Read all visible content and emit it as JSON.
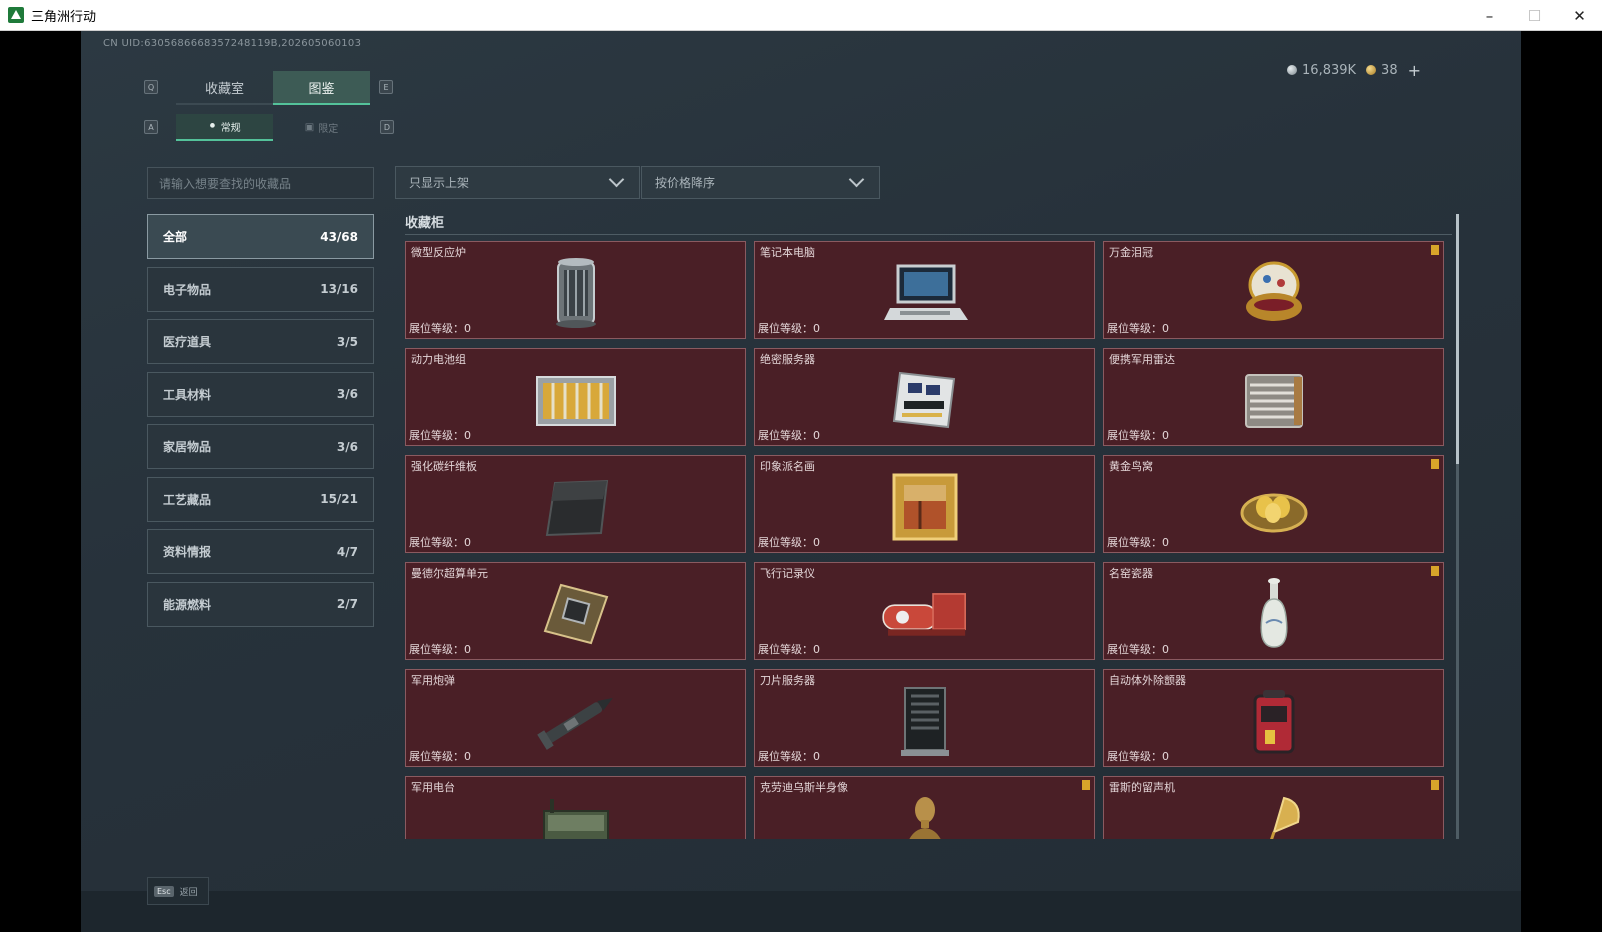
{
  "window": {
    "title": "三角洲行动"
  },
  "header": {
    "uid": "CN UID:6305686668357248119B,202605060103"
  },
  "currency": {
    "silver": "16,839K",
    "gold": "38"
  },
  "keys": {
    "tab_left": "Q",
    "tab_right": "E",
    "sub_left": "A",
    "sub_right": "D"
  },
  "tabs": [
    {
      "label": "收藏室"
    },
    {
      "label": "图鉴"
    }
  ],
  "subtabs": [
    {
      "label": "常规"
    },
    {
      "label": "限定"
    }
  ],
  "search": {
    "placeholder": "请输入想要查找的收藏品"
  },
  "filters": {
    "listing": "只显示上架",
    "sort": "按价格降序"
  },
  "categories": [
    {
      "label": "全部",
      "count": "43/68"
    },
    {
      "label": "电子物品",
      "count": "13/16"
    },
    {
      "label": "医疗道具",
      "count": "3/5"
    },
    {
      "label": "工具材料",
      "count": "3/6"
    },
    {
      "label": "家居物品",
      "count": "3/6"
    },
    {
      "label": "工艺藏品",
      "count": "15/21"
    },
    {
      "label": "资料情报",
      "count": "4/7"
    },
    {
      "label": "能源燃料",
      "count": "2/7"
    }
  ],
  "section": {
    "title": "收藏柜"
  },
  "items": [
    {
      "name": "微型反应炉",
      "level": "展位等级：0"
    },
    {
      "name": "笔记本电脑",
      "level": "展位等级：0"
    },
    {
      "name": "万金泪冠",
      "level": "展位等级：0"
    },
    {
      "name": "动力电池组",
      "level": "展位等级：0"
    },
    {
      "name": "绝密服务器",
      "level": "展位等级：0"
    },
    {
      "name": "便携军用雷达",
      "level": "展位等级：0"
    },
    {
      "name": "强化碳纤维板",
      "level": "展位等级：0"
    },
    {
      "name": "印象派名画",
      "level": "展位等级：0"
    },
    {
      "name": "黄金鸟窝",
      "level": "展位等级：0"
    },
    {
      "name": "曼德尔超算单元",
      "level": "展位等级：0"
    },
    {
      "name": "飞行记录仪",
      "level": "展位等级：0"
    },
    {
      "name": "名窑瓷器",
      "level": "展位等级：0"
    },
    {
      "name": "军用炮弹",
      "level": "展位等级：0"
    },
    {
      "name": "刀片服务器",
      "level": "展位等级：0"
    },
    {
      "name": "自动体外除颤器",
      "level": "展位等级：0"
    },
    {
      "name": "军用电台",
      "level": ""
    },
    {
      "name": "克劳迪乌斯半身像",
      "level": ""
    },
    {
      "name": "雷斯的留声机",
      "level": ""
    }
  ],
  "footer": {
    "esc_key": "Esc",
    "esc_label": "返回"
  }
}
